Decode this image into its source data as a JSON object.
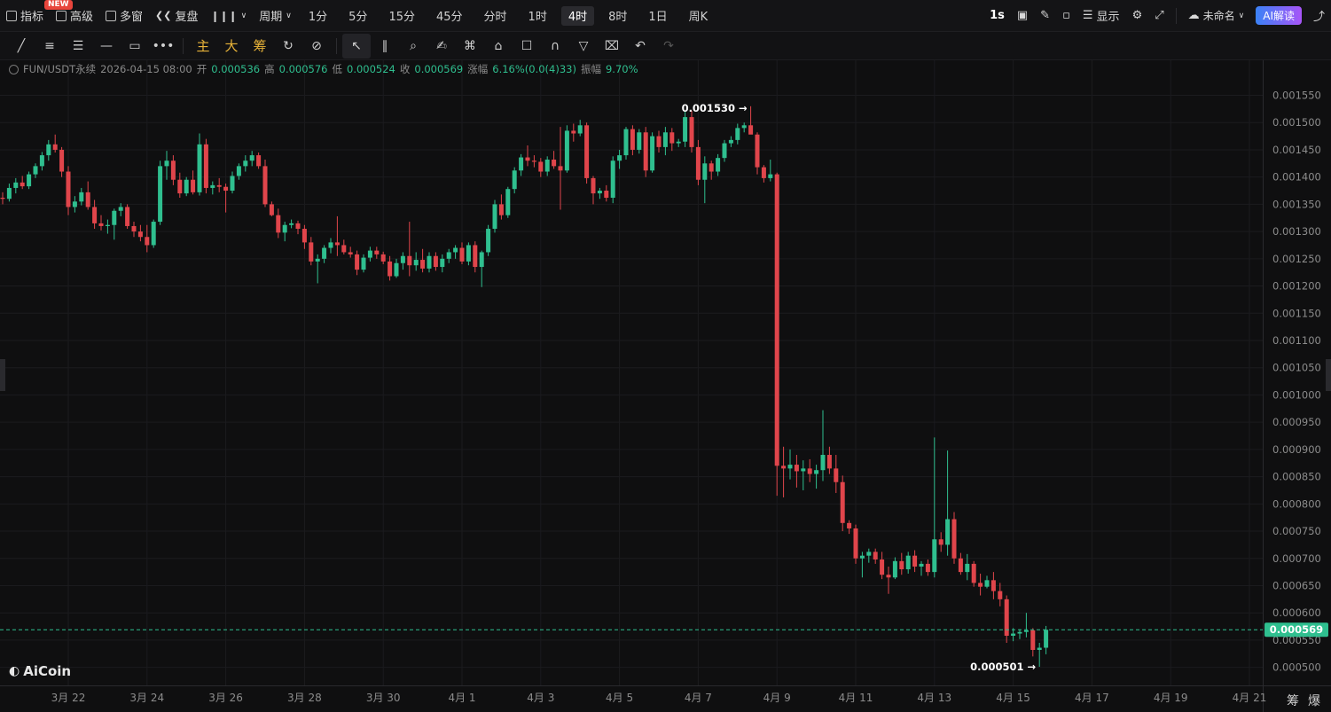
{
  "topbar": {
    "indicator_label": "指标",
    "new_badge": "NEW",
    "advanced_label": "高级",
    "multiwindow_label": "多窗",
    "replay_label": "复盘",
    "period_label": "周期",
    "periods": [
      "1分",
      "5分",
      "15分",
      "45分",
      "分时",
      "1时",
      "4时",
      "8时",
      "1日",
      "周K"
    ],
    "active_period": "4时",
    "interval_label": "1s",
    "display_label": "显示",
    "layout_name": "未命名",
    "ai_label": "AI解读"
  },
  "toolbar": {
    "main_label": "主",
    "big_label": "大",
    "chip_label": "筹"
  },
  "info": {
    "symbol": "FUN/USDT永续",
    "datetime": "2026-04-15 08:00",
    "open_label": "开",
    "open": "0.000536",
    "high_label": "高",
    "high": "0.000576",
    "low_label": "低",
    "low": "0.000524",
    "close_label": "收",
    "close": "0.000569",
    "change_label": "涨幅",
    "change": "6.16%(0.0(4)33)",
    "amplitude_label": "振幅",
    "amplitude": "9.70%"
  },
  "logo_text": "AiCoin",
  "corner_labels": [
    "筹",
    "爆"
  ],
  "colors": {
    "up": "#2fbf8f",
    "down": "#e0454b",
    "background": "#0f0f10",
    "grid": "#1b1b1e"
  },
  "chart_data": {
    "type": "candlestick",
    "ylim": [
      0.000475,
      0.001585
    ],
    "y_ticks": [
      "0.001550",
      "0.001500",
      "0.001450",
      "0.001400",
      "0.001350",
      "0.001300",
      "0.001250",
      "0.001200",
      "0.001150",
      "0.001100",
      "0.001050",
      "0.001000",
      "0.000950",
      "0.000900",
      "0.000850",
      "0.000800",
      "0.000750",
      "0.000700",
      "0.000650",
      "0.000600",
      "0.000550",
      "0.000500"
    ],
    "x_ticks": [
      {
        "label": "3月 22",
        "index": 10
      },
      {
        "label": "3月 24",
        "index": 22
      },
      {
        "label": "3月 26",
        "index": 34
      },
      {
        "label": "3月 28",
        "index": 46
      },
      {
        "label": "3月 30",
        "index": 58
      },
      {
        "label": "4月 1",
        "index": 70
      },
      {
        "label": "4月 3",
        "index": 82
      },
      {
        "label": "4月 5",
        "index": 94
      },
      {
        "label": "4月 7",
        "index": 106
      },
      {
        "label": "4月 9",
        "index": 118
      },
      {
        "label": "4月 11",
        "index": 130
      },
      {
        "label": "4月 13",
        "index": 142
      },
      {
        "label": "4月 15",
        "index": 154
      },
      {
        "label": "4月 17",
        "index": 166
      },
      {
        "label": "4月 19",
        "index": 178
      },
      {
        "label": "4月 21",
        "index": 190
      }
    ],
    "max_label": "0.001530",
    "min_label": "0.000501",
    "last_price_label": "0.000569",
    "last_price": 0.000569,
    "candles": [
      [
        0.001362,
        0.001372,
        0.00135,
        0.00136
      ],
      [
        0.00136,
        0.001388,
        0.001355,
        0.00138
      ],
      [
        0.00138,
        0.001398,
        0.00137,
        0.00139
      ],
      [
        0.00139,
        0.001402,
        0.001378,
        0.001383
      ],
      [
        0.001383,
        0.00141,
        0.001378,
        0.001405
      ],
      [
        0.001405,
        0.001425,
        0.001398,
        0.00142
      ],
      [
        0.00142,
        0.001446,
        0.001412,
        0.00144
      ],
      [
        0.00144,
        0.001468,
        0.00143,
        0.00146
      ],
      [
        0.00146,
        0.001478,
        0.001445,
        0.00145
      ],
      [
        0.00145,
        0.001455,
        0.0014,
        0.00141
      ],
      [
        0.00141,
        0.00142,
        0.00133,
        0.001345
      ],
      [
        0.001345,
        0.001365,
        0.001335,
        0.001355
      ],
      [
        0.001355,
        0.00138,
        0.001348,
        0.001372
      ],
      [
        0.001372,
        0.001392,
        0.00134,
        0.001345
      ],
      [
        0.001345,
        0.001358,
        0.001305,
        0.001315
      ],
      [
        0.001315,
        0.00133,
        0.001302,
        0.00131
      ],
      [
        0.00131,
        0.001322,
        0.001296,
        0.001312
      ],
      [
        0.001312,
        0.001342,
        0.001285,
        0.001338
      ],
      [
        0.001338,
        0.001352,
        0.001328,
        0.001345
      ],
      [
        0.001345,
        0.00135,
        0.001305,
        0.00131
      ],
      [
        0.00131,
        0.001318,
        0.00129,
        0.0013
      ],
      [
        0.0013,
        0.001312,
        0.001282,
        0.00129
      ],
      [
        0.00129,
        0.001312,
        0.001262,
        0.001275
      ],
      [
        0.001275,
        0.001322,
        0.00127,
        0.001318
      ],
      [
        0.001318,
        0.00143,
        0.001312,
        0.00142
      ],
      [
        0.00142,
        0.001448,
        0.001395,
        0.00143
      ],
      [
        0.00143,
        0.00144,
        0.001385,
        0.001395
      ],
      [
        0.001395,
        0.001408,
        0.001362,
        0.00137
      ],
      [
        0.00137,
        0.0014,
        0.001365,
        0.001395
      ],
      [
        0.001395,
        0.001412,
        0.001368,
        0.001372
      ],
      [
        0.001372,
        0.00148,
        0.001366,
        0.00146
      ],
      [
        0.00146,
        0.00147,
        0.00137,
        0.00138
      ],
      [
        0.00138,
        0.001392,
        0.001368,
        0.001385
      ],
      [
        0.001385,
        0.001398,
        0.001372,
        0.001382
      ],
      [
        0.001382,
        0.001388,
        0.001335,
        0.001375
      ],
      [
        0.001375,
        0.00141,
        0.00137,
        0.001402
      ],
      [
        0.001402,
        0.001425,
        0.001395,
        0.00142
      ],
      [
        0.00142,
        0.00144,
        0.00141,
        0.00143
      ],
      [
        0.00143,
        0.001448,
        0.00142,
        0.00144
      ],
      [
        0.00144,
        0.001445,
        0.001415,
        0.00142
      ],
      [
        0.00142,
        0.001432,
        0.001345,
        0.00135
      ],
      [
        0.00135,
        0.001355,
        0.001328,
        0.00133
      ],
      [
        0.00133,
        0.001342,
        0.001288,
        0.001298
      ],
      [
        0.001298,
        0.001318,
        0.001282,
        0.001312
      ],
      [
        0.001312,
        0.001322,
        0.001306,
        0.001315
      ],
      [
        0.001315,
        0.00132,
        0.001295,
        0.001305
      ],
      [
        0.001305,
        0.001312,
        0.001268,
        0.00128
      ],
      [
        0.00128,
        0.00129,
        0.001238,
        0.001245
      ],
      [
        0.001245,
        0.001258,
        0.001205,
        0.00125
      ],
      [
        0.00125,
        0.001275,
        0.001242,
        0.00127
      ],
      [
        0.00127,
        0.001288,
        0.00126,
        0.00128
      ],
      [
        0.00128,
        0.001328,
        0.001255,
        0.001275
      ],
      [
        0.001275,
        0.001285,
        0.001258,
        0.001262
      ],
      [
        0.001262,
        0.001272,
        0.001252,
        0.001258
      ],
      [
        0.001258,
        0.001265,
        0.00122,
        0.00123
      ],
      [
        0.00123,
        0.001258,
        0.001225,
        0.001252
      ],
      [
        0.001252,
        0.001272,
        0.001245,
        0.001265
      ],
      [
        0.001265,
        0.001272,
        0.00125,
        0.001258
      ],
      [
        0.001258,
        0.001263,
        0.00124,
        0.001245
      ],
      [
        0.001245,
        0.001255,
        0.00121,
        0.001218
      ],
      [
        0.001218,
        0.00125,
        0.001215,
        0.001242
      ],
      [
        0.001242,
        0.001262,
        0.00123,
        0.001255
      ],
      [
        0.001255,
        0.001318,
        0.001218,
        0.001238
      ],
      [
        0.001238,
        0.001262,
        0.001228,
        0.001248
      ],
      [
        0.001248,
        0.001268,
        0.001225,
        0.001232
      ],
      [
        0.001232,
        0.001262,
        0.001225,
        0.001255
      ],
      [
        0.001255,
        0.001262,
        0.001228,
        0.001235
      ],
      [
        0.001235,
        0.001258,
        0.001225,
        0.00125
      ],
      [
        0.00125,
        0.001268,
        0.001242,
        0.001262
      ],
      [
        0.001262,
        0.001275,
        0.00125,
        0.00127
      ],
      [
        0.00127,
        0.00128,
        0.00124,
        0.001245
      ],
      [
        0.001245,
        0.00128,
        0.001238,
        0.001275
      ],
      [
        0.001275,
        0.001282,
        0.001225,
        0.001235
      ],
      [
        0.001235,
        0.001265,
        0.001198,
        0.001262
      ],
      [
        0.001262,
        0.001312,
        0.001255,
        0.001305
      ],
      [
        0.001305,
        0.001358,
        0.001298,
        0.00135
      ],
      [
        0.00135,
        0.001368,
        0.001322,
        0.00133
      ],
      [
        0.00133,
        0.001382,
        0.001325,
        0.001378
      ],
      [
        0.001378,
        0.001418,
        0.00137,
        0.001412
      ],
      [
        0.001412,
        0.001442,
        0.001402,
        0.001436
      ],
      [
        0.001436,
        0.001458,
        0.00142,
        0.00143
      ],
      [
        0.00143,
        0.00144,
        0.001418,
        0.001428
      ],
      [
        0.001428,
        0.001435,
        0.0014,
        0.00141
      ],
      [
        0.00141,
        0.001438,
        0.001402,
        0.001432
      ],
      [
        0.001432,
        0.001448,
        0.001415,
        0.00142
      ],
      [
        0.00142,
        0.001492,
        0.00134,
        0.001412
      ],
      [
        0.001412,
        0.001495,
        0.001408,
        0.001485
      ],
      [
        0.001485,
        0.001498,
        0.001465,
        0.00148
      ],
      [
        0.00148,
        0.001505,
        0.001475,
        0.001495
      ],
      [
        0.001495,
        0.0015,
        0.001388,
        0.001398
      ],
      [
        0.001398,
        0.001402,
        0.00135,
        0.00137
      ],
      [
        0.00137,
        0.00138,
        0.00136,
        0.001375
      ],
      [
        0.001375,
        0.001385,
        0.001355,
        0.001362
      ],
      [
        0.001362,
        0.001438,
        0.001352,
        0.00143
      ],
      [
        0.00143,
        0.00145,
        0.001415,
        0.00144
      ],
      [
        0.00144,
        0.001492,
        0.001432,
        0.001488
      ],
      [
        0.001488,
        0.001495,
        0.00144,
        0.00145
      ],
      [
        0.00145,
        0.001488,
        0.001443,
        0.001482
      ],
      [
        0.001482,
        0.001492,
        0.0014,
        0.001412
      ],
      [
        0.001412,
        0.001482,
        0.001408,
        0.001475
      ],
      [
        0.001475,
        0.001485,
        0.001445,
        0.001455
      ],
      [
        0.001455,
        0.001492,
        0.00144,
        0.001482
      ],
      [
        0.001482,
        0.00149,
        0.001448,
        0.001462
      ],
      [
        0.001462,
        0.00147,
        0.001455,
        0.001465
      ],
      [
        0.001465,
        0.00152,
        0.001455,
        0.00151
      ],
      [
        0.00151,
        0.001522,
        0.001445,
        0.001455
      ],
      [
        0.001455,
        0.001468,
        0.001385,
        0.001395
      ],
      [
        0.001395,
        0.001438,
        0.001352,
        0.001425
      ],
      [
        0.001425,
        0.00143,
        0.001395,
        0.00141
      ],
      [
        0.00141,
        0.001442,
        0.001402,
        0.001435
      ],
      [
        0.001435,
        0.001468,
        0.001428,
        0.001462
      ],
      [
        0.001462,
        0.001475,
        0.001455,
        0.001468
      ],
      [
        0.001468,
        0.001498,
        0.00146,
        0.00149
      ],
      [
        0.00149,
        0.0015,
        0.001482,
        0.001495
      ],
      [
        0.001495,
        0.00153,
        0.001485,
        0.001478
      ],
      [
        0.001478,
        0.001482,
        0.001405,
        0.001418
      ],
      [
        0.001418,
        0.001422,
        0.00139,
        0.001398
      ],
      [
        0.001398,
        0.001432,
        0.001392,
        0.001405
      ],
      [
        0.001405,
        0.001408,
        0.000815,
        0.00087
      ],
      [
        0.00087,
        0.000905,
        0.000812,
        0.000865
      ],
      [
        0.000865,
        0.0009,
        0.000845,
        0.000872
      ],
      [
        0.000872,
        0.00089,
        0.00083,
        0.00086
      ],
      [
        0.00086,
        0.00088,
        0.000825,
        0.000865
      ],
      [
        0.000865,
        0.000882,
        0.00084,
        0.000855
      ],
      [
        0.000855,
        0.000872,
        0.000828,
        0.000862
      ],
      [
        0.000862,
        0.000972,
        0.000842,
        0.00089
      ],
      [
        0.00089,
        0.000905,
        0.000855,
        0.000865
      ],
      [
        0.000865,
        0.00089,
        0.00082,
        0.00084
      ],
      [
        0.00084,
        0.000852,
        0.00075,
        0.000765
      ],
      [
        0.000765,
        0.00077,
        0.000745,
        0.000755
      ],
      [
        0.000755,
        0.000762,
        0.00069,
        0.0007
      ],
      [
        0.0007,
        0.000712,
        0.000665,
        0.000705
      ],
      [
        0.000705,
        0.000718,
        0.000692,
        0.000712
      ],
      [
        0.000712,
        0.000718,
        0.00069,
        0.000698
      ],
      [
        0.000698,
        0.000712,
        0.000662,
        0.00067
      ],
      [
        0.00067,
        0.000685,
        0.000635,
        0.000665
      ],
      [
        0.000665,
        0.000702,
        0.000662,
        0.000695
      ],
      [
        0.000695,
        0.00071,
        0.00067,
        0.00068
      ],
      [
        0.00068,
        0.000712,
        0.000672,
        0.000705
      ],
      [
        0.000705,
        0.000715,
        0.000675,
        0.000685
      ],
      [
        0.000685,
        0.000695,
        0.000668,
        0.00069
      ],
      [
        0.00069,
        0.000698,
        0.000668,
        0.000675
      ],
      [
        0.000675,
        0.000922,
        0.000665,
        0.000735
      ],
      [
        0.000735,
        0.000748,
        0.000712,
        0.000725
      ],
      [
        0.000725,
        0.000898,
        0.000705,
        0.000772
      ],
      [
        0.000772,
        0.000785,
        0.00069,
        0.0007
      ],
      [
        0.0007,
        0.00071,
        0.00067,
        0.000675
      ],
      [
        0.000675,
        0.000708,
        0.00066,
        0.00069
      ],
      [
        0.00069,
        0.000695,
        0.000648,
        0.000655
      ],
      [
        0.000655,
        0.000672,
        0.000632,
        0.000648
      ],
      [
        0.000648,
        0.000668,
        0.000645,
        0.00066
      ],
      [
        0.00066,
        0.000675,
        0.000625,
        0.00064
      ],
      [
        0.00064,
        0.000655,
        0.000612,
        0.000625
      ],
      [
        0.000625,
        0.000632,
        0.000545,
        0.000558
      ],
      [
        0.000558,
        0.000572,
        0.000548,
        0.000562
      ],
      [
        0.000562,
        0.00057,
        0.000552,
        0.000565
      ],
      [
        0.000565,
        0.0006,
        0.000555,
        0.000568
      ],
      [
        0.000568,
        0.000572,
        0.00052,
        0.000532
      ],
      [
        0.000532,
        0.000545,
        0.000501,
        0.000536
      ],
      [
        0.000536,
        0.000576,
        0.000524,
        0.000569
      ]
    ]
  }
}
